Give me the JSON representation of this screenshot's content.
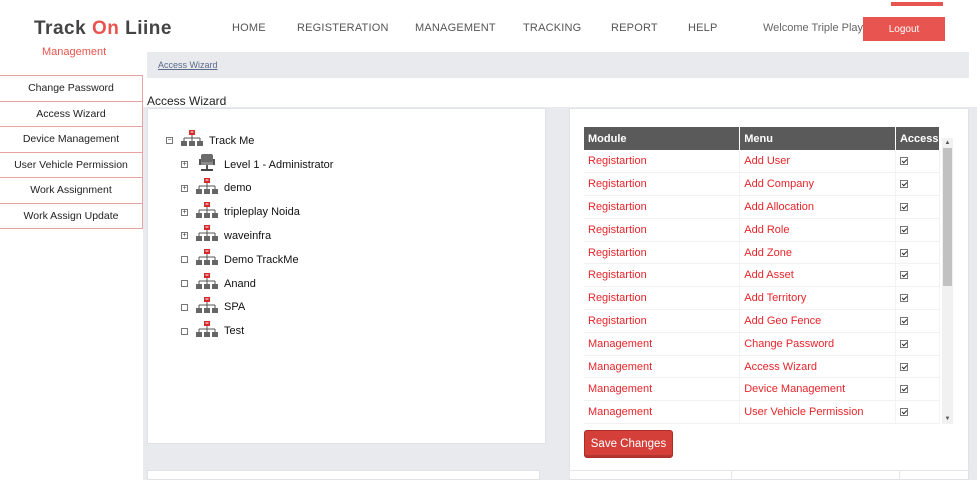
{
  "brand": {
    "part1": "Track ",
    "part2": "On",
    "part3": " Liine",
    "subtitle": "Management"
  },
  "nav": [
    "HOME",
    "REGISTERATION",
    "MANAGEMENT",
    "TRACKING",
    "REPORT",
    "HELP"
  ],
  "header": {
    "welcome": "Welcome Triple Play",
    "logout_label": "Logout"
  },
  "breadcrumb": "Access Wizard",
  "sidebar": [
    "Change Password",
    "Access Wizard",
    "Device Management",
    "User Vehicle Permission",
    "Work Assignment",
    "Work Assign Update"
  ],
  "page_title": "Access Wizard",
  "tree": {
    "root": {
      "label": "Track Me",
      "expander": "−"
    },
    "children": [
      {
        "label": "Level 1 - Administrator",
        "expander": "+",
        "icon": "chair-icon"
      },
      {
        "label": "demo",
        "expander": "+",
        "icon": "org-chart-icon"
      },
      {
        "label": "tripleplay Noida",
        "expander": "+",
        "icon": "org-chart-icon"
      },
      {
        "label": "waveinfra",
        "expander": "+",
        "icon": "org-chart-icon"
      },
      {
        "label": "Demo TrackMe",
        "expander": "",
        "icon": "org-chart-icon"
      },
      {
        "label": "Anand",
        "expander": "",
        "icon": "org-chart-icon"
      },
      {
        "label": "SPA",
        "expander": "",
        "icon": "org-chart-icon"
      },
      {
        "label": "Test",
        "expander": "",
        "icon": "org-chart-icon"
      }
    ]
  },
  "table": {
    "headers": [
      "Module",
      "Menu",
      "Access"
    ],
    "rows": [
      {
        "module": "Registartion",
        "menu": "Add User",
        "access": true
      },
      {
        "module": "Registartion",
        "menu": "Add Company",
        "access": true
      },
      {
        "module": "Registartion",
        "menu": "Add Allocation",
        "access": true
      },
      {
        "module": "Registartion",
        "menu": "Add Role",
        "access": true
      },
      {
        "module": "Registartion",
        "menu": "Add Zone",
        "access": true
      },
      {
        "module": "Registartion",
        "menu": "Add Asset",
        "access": true
      },
      {
        "module": "Registartion",
        "menu": "Add Territory",
        "access": true
      },
      {
        "module": "Registartion",
        "menu": "Add Geo Fence",
        "access": true
      },
      {
        "module": "Management",
        "menu": "Change Password",
        "access": true
      },
      {
        "module": "Management",
        "menu": "Access Wizard",
        "access": true
      },
      {
        "module": "Management",
        "menu": "Device Management",
        "access": true
      },
      {
        "module": "Management",
        "menu": "User Vehicle Permission",
        "access": true
      }
    ]
  },
  "save_label": "Save Changes",
  "colors": {
    "accent": "#e8544f",
    "table_header": "#5a5a5a",
    "link_red": "#e8242a",
    "button": "#d43f3a"
  }
}
